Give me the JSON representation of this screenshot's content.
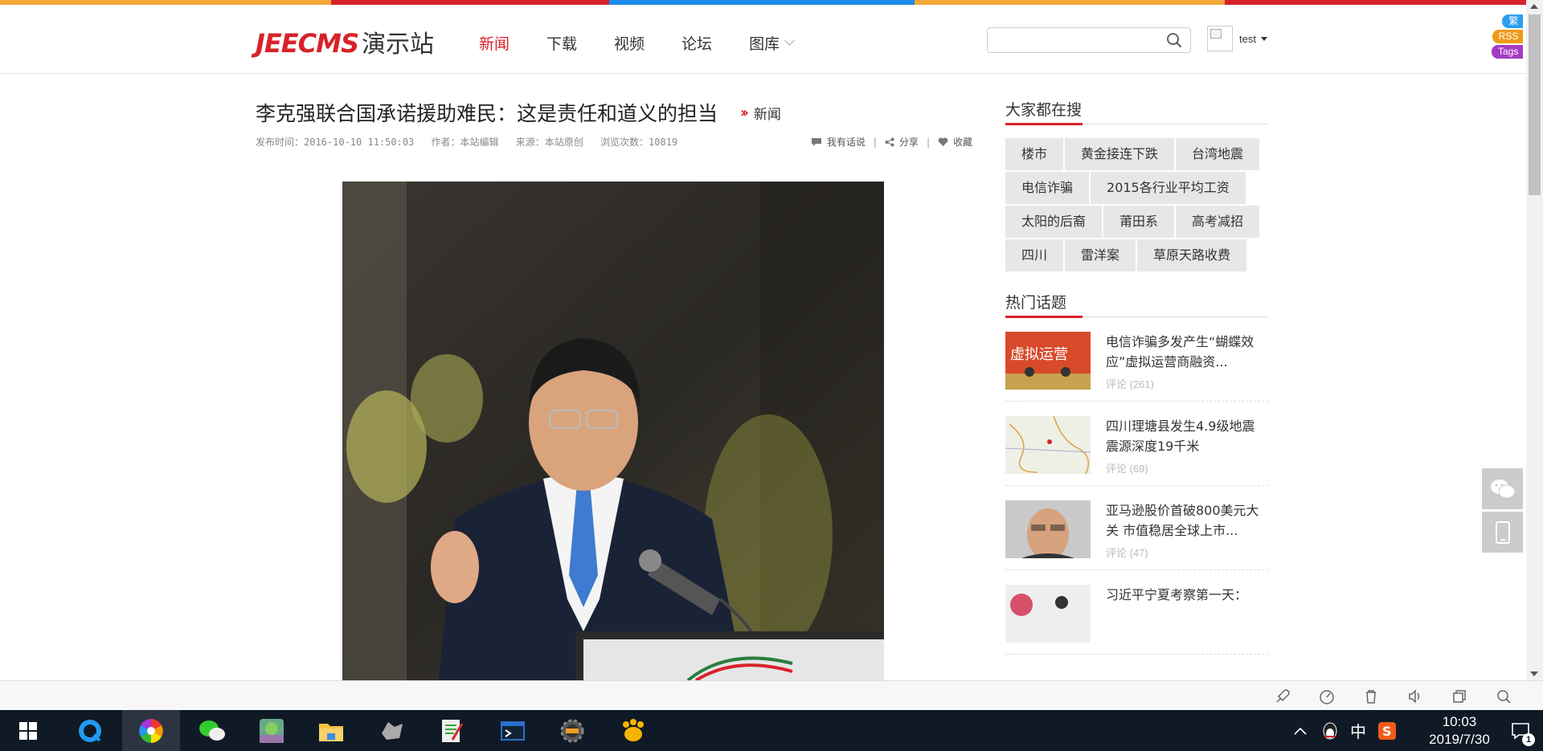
{
  "colors": {
    "accent": "#d8222a",
    "topbar": [
      "#f3a93c",
      "#d8222a",
      "#1d8be8",
      "#f3a93c",
      "#d8222a"
    ]
  },
  "header": {
    "logo_en": "JEECMS",
    "logo_cn": "演示站",
    "nav": [
      {
        "label": "新闻",
        "active": true
      },
      {
        "label": "下载"
      },
      {
        "label": "视频"
      },
      {
        "label": "论坛"
      },
      {
        "label": "图库",
        "has_dropdown": true
      }
    ],
    "search": {
      "value": "",
      "placeholder": ""
    },
    "user": {
      "name": "test"
    },
    "badges": [
      {
        "label": "繁",
        "color": "#2ba0ee"
      },
      {
        "label": "RSS",
        "color": "#f09a1a"
      },
      {
        "label": "Tags",
        "color": "#a43bc4"
      }
    ]
  },
  "article": {
    "title": "李克强联合国承诺援助难民：这是责任和道义的担当",
    "category": "新闻",
    "meta": {
      "publish_time": "发布时间：2016-10-10 11:50:03",
      "author": "作者：本站编辑",
      "source": "来源：本站原创",
      "views": "浏览次数：10819"
    },
    "actions": {
      "comment": "我有话说",
      "share": "分享",
      "favorite": "收藏"
    }
  },
  "sidebar": {
    "search_title": "大家都在搜",
    "tags": [
      "楼市",
      "黄金接连下跌",
      "台湾地震",
      "电信诈骗",
      "2015各行业平均工资",
      "太阳的后裔",
      "莆田系",
      "高考减招",
      "四川",
      "雷洋案",
      "草原天路收费"
    ],
    "topics_title": "热门话题",
    "topics": [
      {
        "title": "电信诈骗多发产生“蝴蝶效应”虚拟运营商融资...",
        "comments": "评论 (261)"
      },
      {
        "title": "四川理塘县发生4.9级地震 震源深度19千米",
        "comments": "评论 (69)"
      },
      {
        "title": "亚马逊股价首破800美元大关 市值稳居全球上市...",
        "comments": "评论 (47)"
      },
      {
        "title": "习近平宁夏考察第一天：",
        "comments": ""
      }
    ]
  },
  "taskbar": {
    "time": "10:03",
    "date": "2019/7/30",
    "ime": "中",
    "notification_count": "1"
  }
}
